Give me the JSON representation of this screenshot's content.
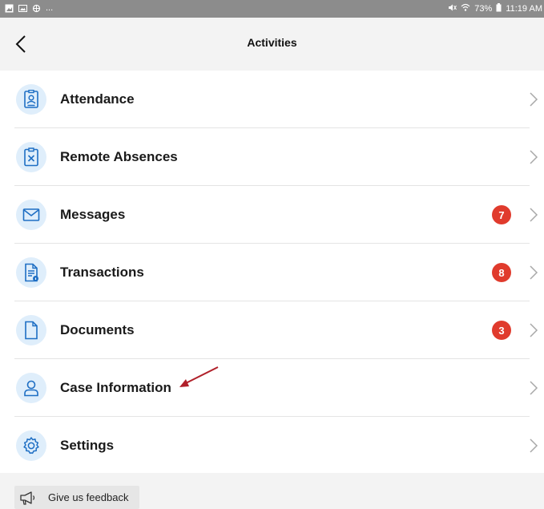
{
  "status_bar": {
    "battery": "73%",
    "time": "11:19 AM",
    "dots": "..."
  },
  "header": {
    "title": "Activities"
  },
  "list": {
    "items": [
      {
        "label": "Attendance",
        "icon": "attendance-badge-icon",
        "badge": ""
      },
      {
        "label": "Remote Absences",
        "icon": "clipboard-x-icon",
        "badge": ""
      },
      {
        "label": "Messages",
        "icon": "envelope-icon",
        "badge": "7"
      },
      {
        "label": "Transactions",
        "icon": "document-info-icon",
        "badge": "8"
      },
      {
        "label": "Documents",
        "icon": "document-icon",
        "badge": "3"
      },
      {
        "label": "Case Information",
        "icon": "person-icon",
        "badge": ""
      },
      {
        "label": "Settings",
        "icon": "gear-icon",
        "badge": ""
      }
    ]
  },
  "feedback": {
    "label": "Give us feedback",
    "icon": "megaphone-icon"
  },
  "colors": {
    "accent": "#1f6fc4",
    "icon_bg": "#dfeefb",
    "badge": "#e03b2d",
    "annotation": "#b0202a"
  }
}
